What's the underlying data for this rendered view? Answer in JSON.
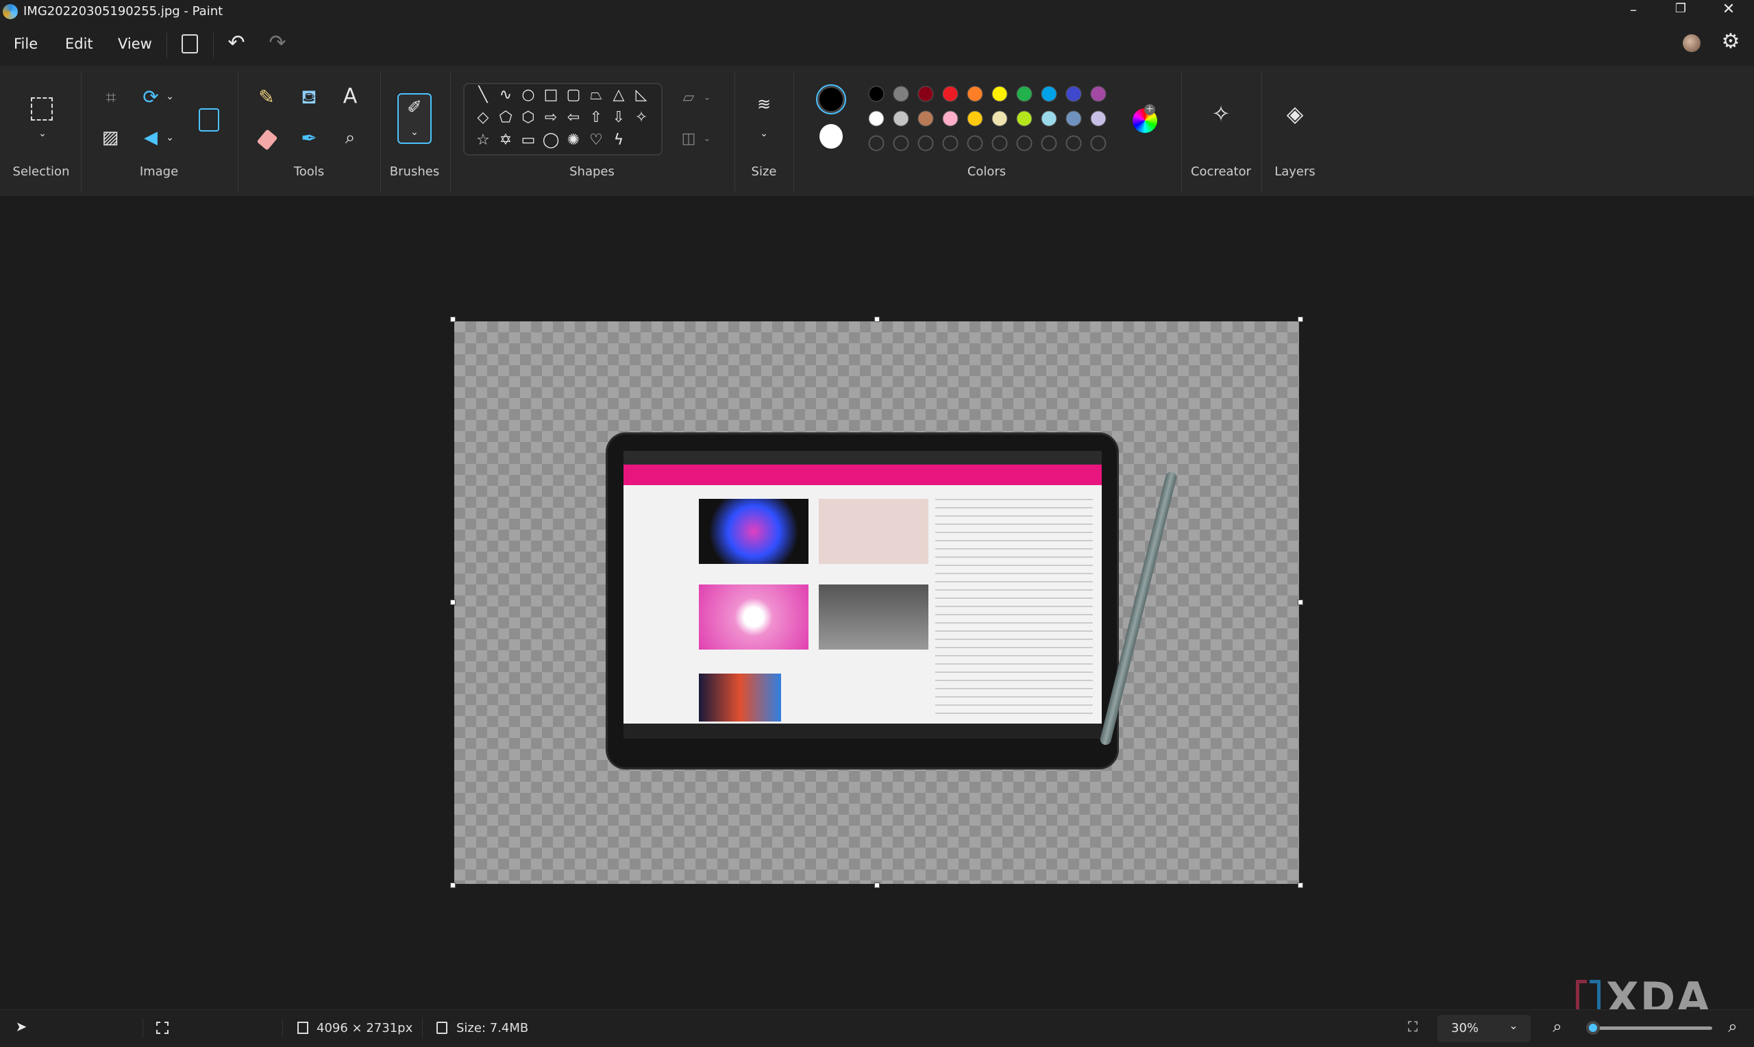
{
  "window": {
    "title": "IMG20220305190255.jpg - Paint",
    "controls": [
      "minimize-icon",
      "restore-icon",
      "close-icon"
    ]
  },
  "menu": {
    "file": "File",
    "edit": "Edit",
    "view": "View"
  },
  "ribbon": {
    "groups": {
      "selection": "Selection",
      "image": "Image",
      "tools": "Tools",
      "brushes": "Brushes",
      "shapes": "Shapes",
      "size": "Size",
      "colors": "Colors",
      "cocreator": "Cocreator",
      "layers": "Layers"
    },
    "shapes": [
      "line",
      "curve",
      "oval",
      "rectangle",
      "rounded-rectangle",
      "polygon",
      "triangle",
      "right-triangle",
      "diamond",
      "pentagon",
      "hexagon",
      "arrow-right",
      "arrow-left",
      "arrow-up",
      "arrow-down",
      "star-four",
      "star-five",
      "star-six",
      "callout-rect",
      "callout-oval",
      "callout-cloud",
      "heart",
      "lightning"
    ],
    "primary_color": "#000000",
    "secondary_color": "#ffffff",
    "palette_row1": [
      "#000000",
      "#7f7f7f",
      "#880015",
      "#ed1c24",
      "#ff7f27",
      "#fff200",
      "#22b14c",
      "#00a2e8",
      "#3f48cc",
      "#a349a4"
    ],
    "palette_row2": [
      "#ffffff",
      "#c3c3c3",
      "#b97a57",
      "#ffaec9",
      "#ffc90e",
      "#efe4b0",
      "#b5e61d",
      "#99d9ea",
      "#7092be",
      "#c8bfe7"
    ],
    "accent": "#4cc2ff"
  },
  "status": {
    "dimensions": "4096 × 2731px",
    "size": "Size: 7.4MB",
    "zoom": "30%",
    "zoom_level_percent": 30
  },
  "watermark": "XDA"
}
